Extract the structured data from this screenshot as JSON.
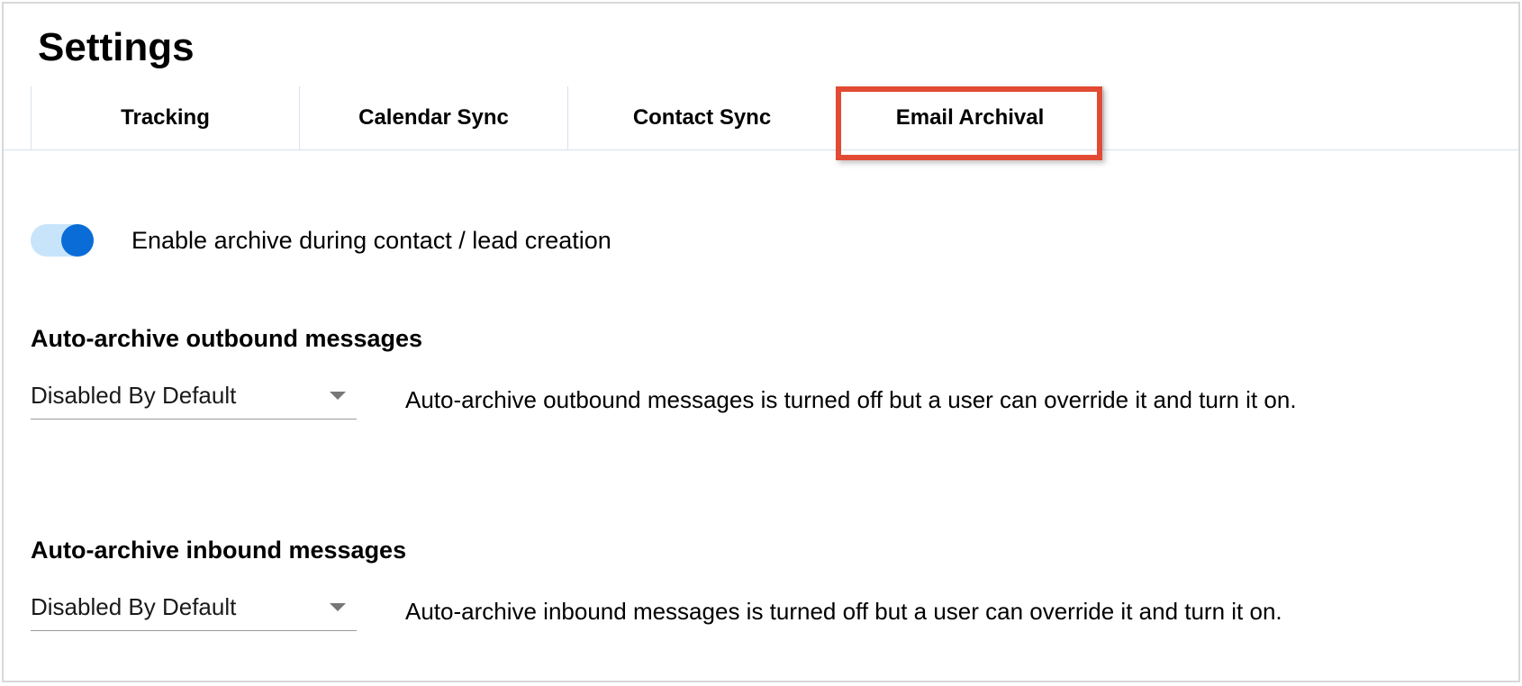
{
  "header": {
    "title": "Settings"
  },
  "tabs": [
    {
      "label": "Tracking"
    },
    {
      "label": "Calendar Sync"
    },
    {
      "label": "Contact Sync"
    },
    {
      "label": "Email Archival"
    }
  ],
  "toggle": {
    "label": "Enable archive during contact / lead creation",
    "enabled": true
  },
  "outbound": {
    "heading": "Auto-archive outbound messages",
    "select_value": "Disabled By Default",
    "description": "Auto-archive outbound messages is turned off but a user can override it and turn it on."
  },
  "inbound": {
    "heading": "Auto-archive inbound messages",
    "select_value": "Disabled By Default",
    "description": "Auto-archive inbound messages is turned off but a user can override it and turn it on."
  }
}
